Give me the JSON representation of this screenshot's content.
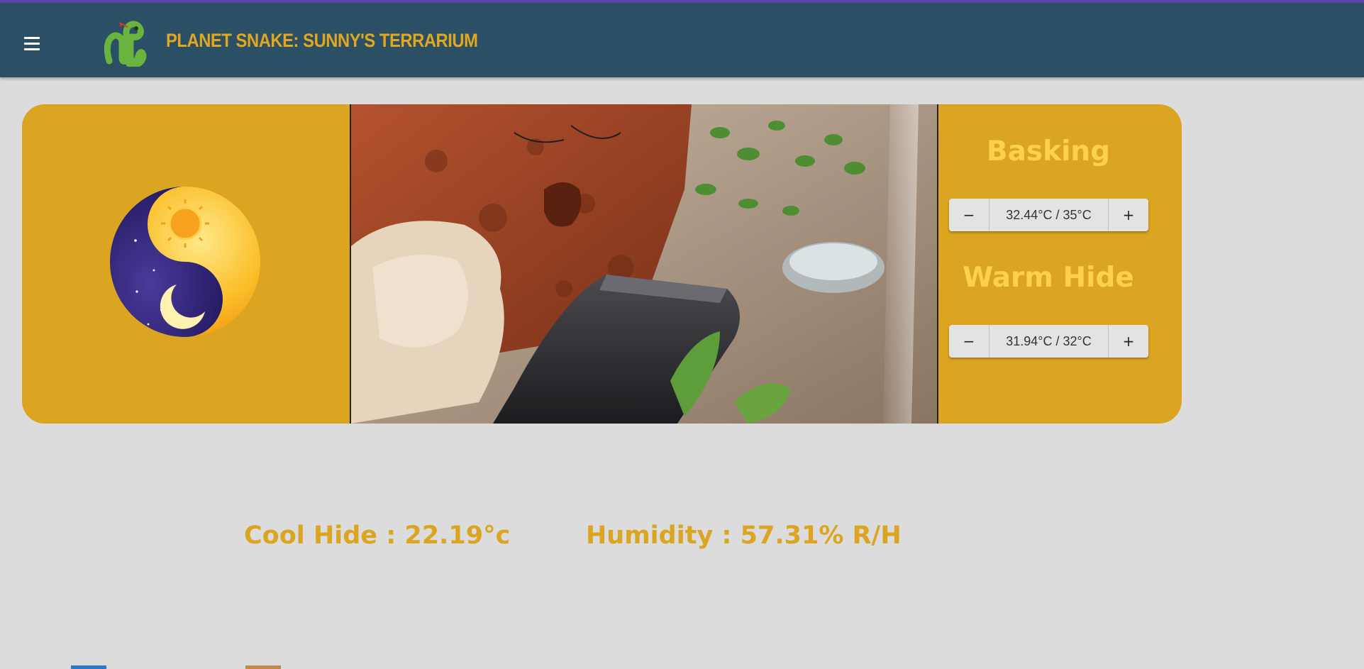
{
  "header": {
    "title": "Planet Snake: Sunny's Terrarium",
    "menu_icon": "hamburger-menu-icon",
    "logo_icon": "snake-logo-icon"
  },
  "panel": {
    "mode_icon": "day-night-yin-yang-icon",
    "camera_feed": "terrarium-camera-feed",
    "basking": {
      "title": "Basking",
      "value": "32.44°C / 35°C",
      "decrement": "−",
      "increment": "+"
    },
    "warm_hide": {
      "title": "Warm Hide",
      "value": "31.94°C / 32°C",
      "decrement": "−",
      "increment": "+"
    }
  },
  "readings": {
    "cool_hide": "Cool Hide : 22.19°c",
    "humidity": "Humidity : 57.31% R/H"
  },
  "colors": {
    "appbar": "#2b4f64",
    "accent": "#dba521",
    "title_gold": "#e0a71f",
    "zone_title": "#fdd14a",
    "background": "#dcdcdc"
  }
}
